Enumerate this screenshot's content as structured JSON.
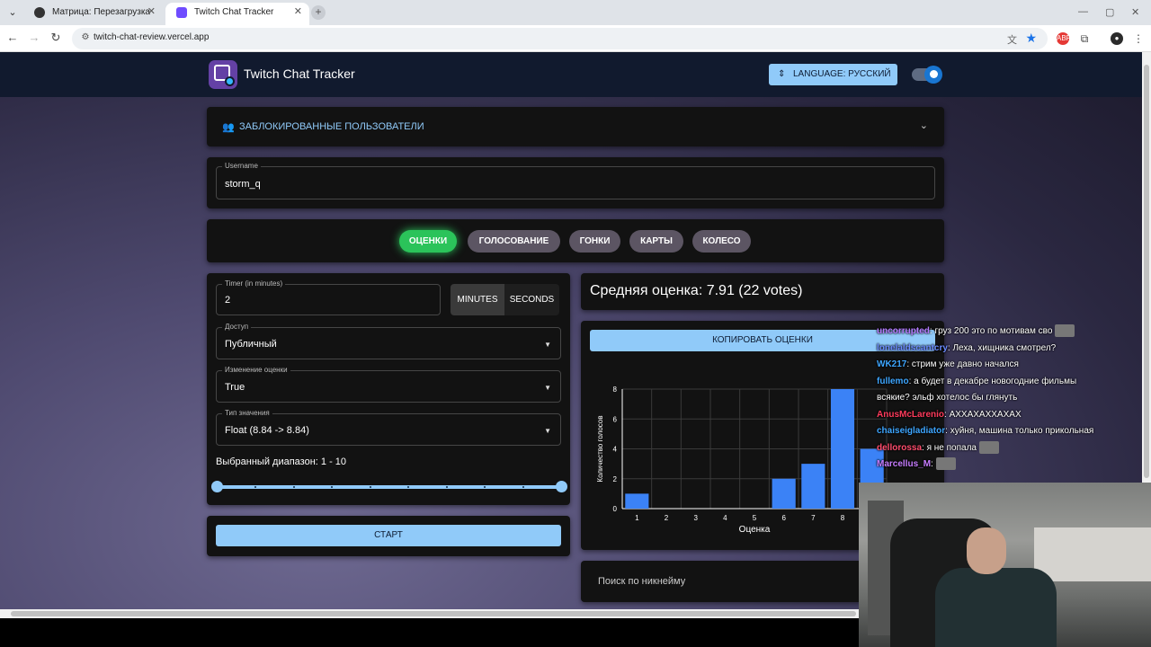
{
  "browser": {
    "tabs": [
      {
        "title": "Матрица: Перезагрузка",
        "active": false
      },
      {
        "title": "Twitch Chat Tracker",
        "active": true
      }
    ],
    "url": "twitch-chat-review.vercel.app"
  },
  "app": {
    "title": "Twitch Chat Tracker",
    "language_label": "LANGUAGE: РУССКИЙ",
    "dark_mode": true
  },
  "blocked": {
    "label": "ЗАБЛОКИРОВАННЫЕ ПОЛЬЗОВАТЕЛИ"
  },
  "username": {
    "label": "Username",
    "value": "storm_q"
  },
  "modes": [
    "ОЦЕНКИ",
    "ГОЛОСОВАНИЕ",
    "ГОНКИ",
    "КАРТЫ",
    "КОЛЕСО"
  ],
  "active_mode": "ОЦЕНКИ",
  "settings": {
    "timer_label": "Timer (in minutes)",
    "timer_value": "2",
    "units": [
      "MINUTES",
      "SECONDS"
    ],
    "active_unit": "MINUTES",
    "access_label": "Доступ",
    "access_value": "Публичный",
    "change_label": "Изменение оценки",
    "change_value": "True",
    "type_label": "Тип значения",
    "type_value": "Float (8.84 -> 8.84)",
    "range_text": "Выбранный диапазон: 1 - 10",
    "range_min": 1,
    "range_max": 10
  },
  "start_label": "СТАРТ",
  "average": "Средняя оценка: 7.91 (22 votes)",
  "copy_label": "КОПИРОВАТЬ ОЦЕНКИ",
  "search_placeholder": "Поиск по никнейму",
  "chart_data": {
    "type": "bar",
    "categories": [
      "1",
      "2",
      "3",
      "4",
      "5",
      "6",
      "7",
      "8",
      "9"
    ],
    "values": [
      1,
      0,
      0,
      0,
      0,
      2,
      3,
      8,
      4
    ],
    "xlabel": "Оценка",
    "ylabel": "Количество голосов",
    "ylim": [
      0,
      8
    ],
    "yticks": [
      0,
      2,
      4,
      6,
      8
    ],
    "grid": true,
    "bar_color": "#3b82f6"
  },
  "chat": [
    {
      "user": "uncorrupted",
      "color": "#b57cff",
      "text": ": груз 200 это по мотивам сво",
      "emote": true
    },
    {
      "user": "lonelaldscantcry",
      "color": "#6b8cff",
      "text": ": Леха, хищника смотрел?",
      "emote": false
    },
    {
      "user": "WK217",
      "color": "#3ea6ff",
      "text": ": стрим уже давно начался",
      "emote": false
    },
    {
      "user": "fullemo",
      "color": "#3ea6ff",
      "text": ": а будет в декабре новогодние фильмы",
      "emote": false
    },
    {
      "user": "",
      "color": "#ffffff",
      "text": "всякие? эльф хотелос бы глянуть",
      "emote": false
    },
    {
      "user": "AnusMcLarenio",
      "color": "#ff3b5c",
      "text": ": АХХАХАХХАХАХ",
      "emote": false
    },
    {
      "user": "chaiseigladiator",
      "color": "#3ea6ff",
      "text": ": хуйня, машина только прикольная",
      "emote": false
    },
    {
      "user": "dellorossa",
      "color": "#ff4d6d",
      "text": ": я не попала",
      "emote": true
    },
    {
      "user": "Marcellus_M",
      "color": "#c77dff",
      "text": ":",
      "emote": true
    }
  ]
}
